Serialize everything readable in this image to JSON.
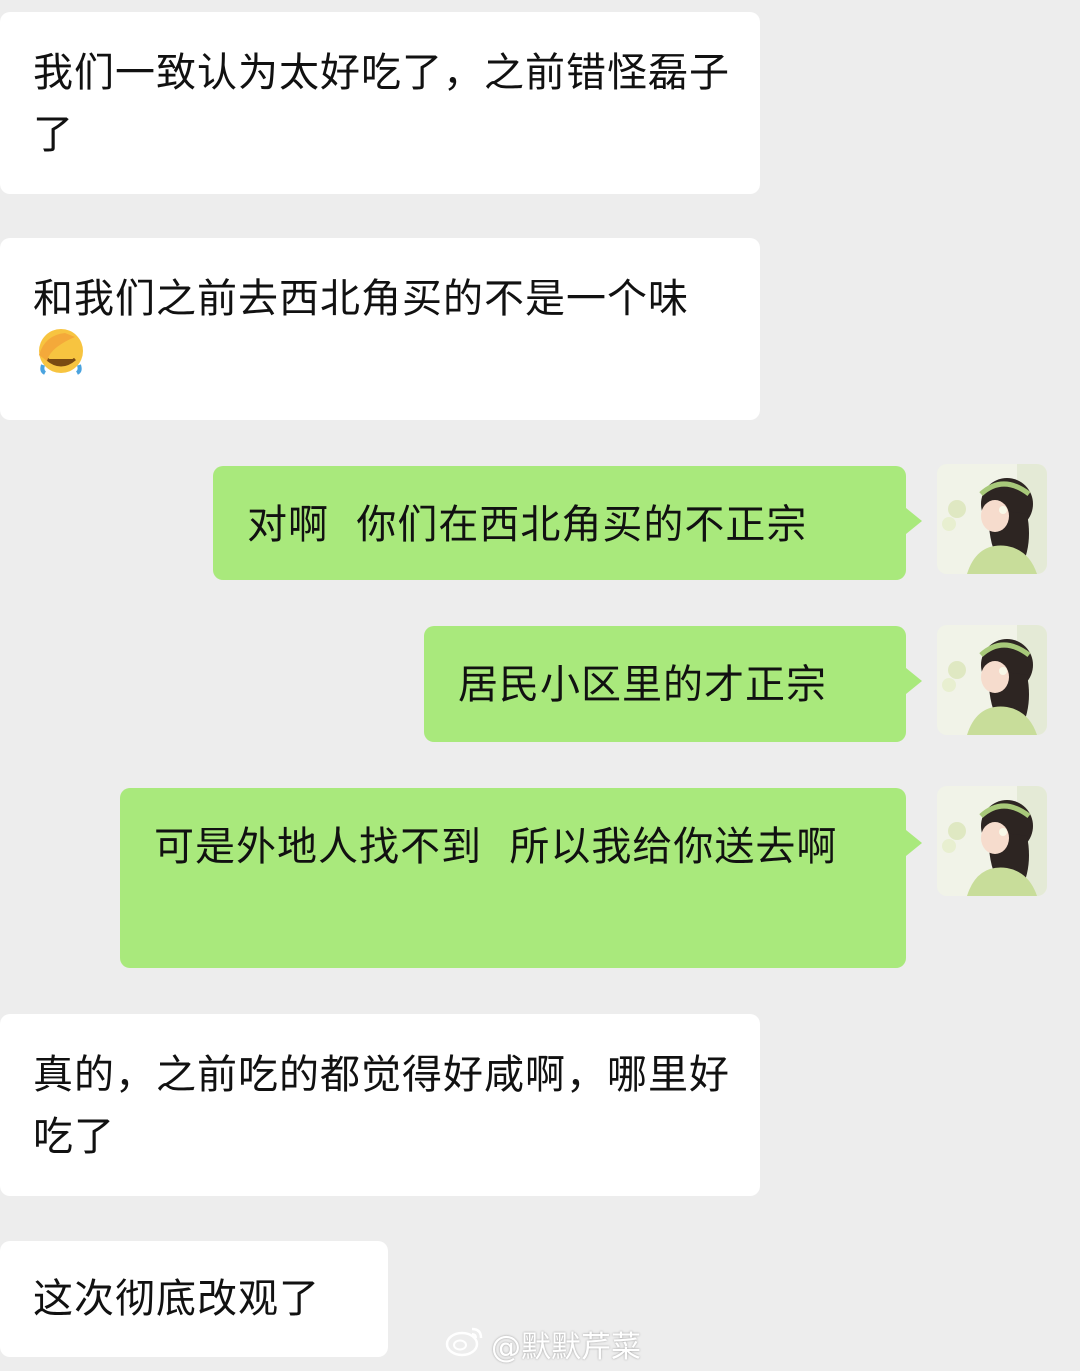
{
  "messages": [
    {
      "side": "left",
      "text": "我们一致认为太好吃了，之前错怪磊子了"
    },
    {
      "side": "left",
      "text": "和我们之前去西北角买的不是一个味",
      "emoji": "facepalm-emoji"
    },
    {
      "side": "right",
      "text": "对啊  你们在西北角买的不正宗"
    },
    {
      "side": "right",
      "text": "居民小区里的才正宗"
    },
    {
      "side": "right",
      "text": "可是外地人找不到  所以我给你送去啊"
    },
    {
      "side": "left",
      "text": "真的，之前吃的都觉得好咸啊，哪里好吃了"
    },
    {
      "side": "left",
      "text": "这次彻底改观了"
    }
  ],
  "watermark": {
    "icon": "weibo-icon",
    "text": "@默默芹菜"
  },
  "colors": {
    "background": "#ededed",
    "incoming_bubble": "#ffffff",
    "outgoing_bubble": "#a9e97c"
  }
}
